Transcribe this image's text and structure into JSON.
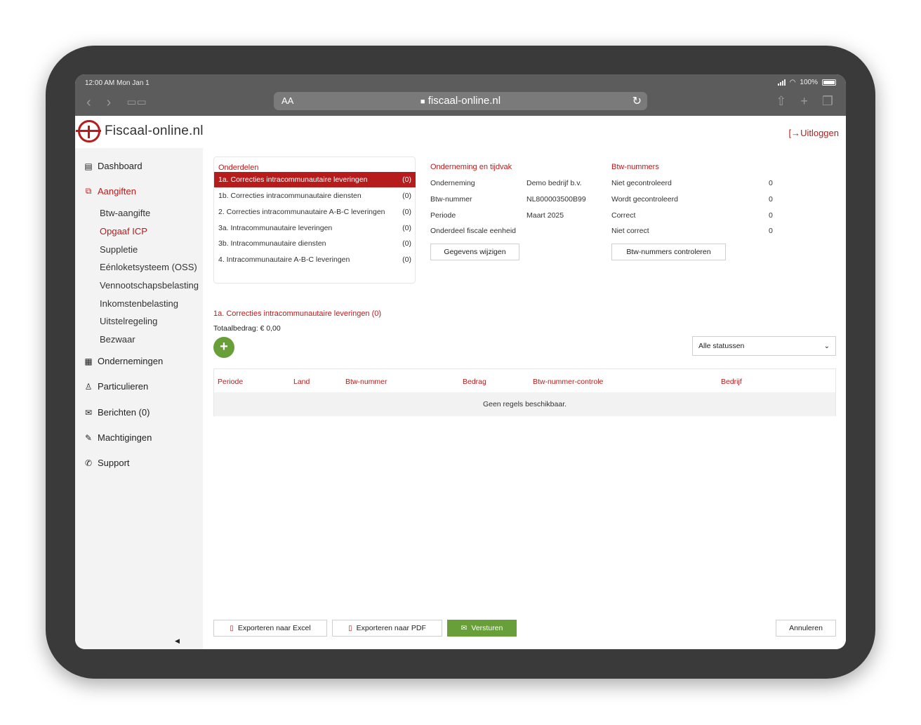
{
  "status_bar": {
    "time": "12:00 AM  Mon Jan 1",
    "battery": "100%"
  },
  "browser": {
    "aa_label": "AA",
    "url": "fiscaal-online.nl"
  },
  "brand": {
    "name": "Fiscaal-online.nl",
    "logout": "Uitloggen",
    "accent": "#b71c1c",
    "green": "#689f38"
  },
  "sidebar": {
    "dashboard": "Dashboard",
    "aangiften": "Aangiften",
    "sub": [
      "Btw-aangifte",
      "Opgaaf ICP",
      "Suppletie",
      "Eénloketsysteem (OSS)",
      "Vennootschapsbelasting",
      "Inkomstenbelasting",
      "Uitstelregeling",
      "Bezwaar"
    ],
    "ondernemingen": "Ondernemingen",
    "particulieren": "Particulieren",
    "berichten": "Berichten (0)",
    "machtigingen": "Machtigingen",
    "support": "Support"
  },
  "onderdelen": {
    "title": "Onderdelen",
    "rows": [
      {
        "label": "1a. Correcties intracommunautaire leveringen",
        "count": "(0)"
      },
      {
        "label": "1b. Correcties intracommunautaire diensten",
        "count": "(0)"
      },
      {
        "label": "2. Correcties intracommunautaire A-B-C leveringen",
        "count": "(0)"
      },
      {
        "label": "3a. Intracommunautaire leveringen",
        "count": "(0)"
      },
      {
        "label": "3b. Intracommunautaire diensten",
        "count": "(0)"
      },
      {
        "label": "4. Intracommunautaire A-B-C leveringen",
        "count": "(0)"
      }
    ]
  },
  "onderneming": {
    "title": "Onderneming en tijdvak",
    "labels": [
      "Onderneming",
      "Btw-nummer",
      "Periode",
      "Onderdeel fiscale eenheid"
    ],
    "values": [
      "Demo bedrijf b.v.",
      "NL800003500B99",
      "Maart 2025",
      ""
    ],
    "button": "Gegevens wijzigen"
  },
  "btw_nummers": {
    "title": "Btw-nummers",
    "labels": [
      "Niet gecontroleerd",
      "Wordt gecontroleerd",
      "Correct",
      "Niet correct"
    ],
    "values": [
      "0",
      "0",
      "0",
      "0"
    ],
    "button": "Btw-nummers controleren"
  },
  "list": {
    "title": "1a. Correcties intracommunautaire leveringen (0)",
    "total": "Totaalbedrag: € 0,00",
    "add": "+",
    "filter": "Alle statussen",
    "columns": [
      "Periode",
      "Land",
      "Btw-nummer",
      "Bedrag",
      "Btw-nummer-controle",
      "Bedrijf"
    ],
    "empty": "Geen regels beschikbaar."
  },
  "footer": {
    "excel": "Exporteren naar Excel",
    "pdf": "Exporteren naar PDF",
    "send": "Versturen",
    "cancel": "Annuleren"
  }
}
